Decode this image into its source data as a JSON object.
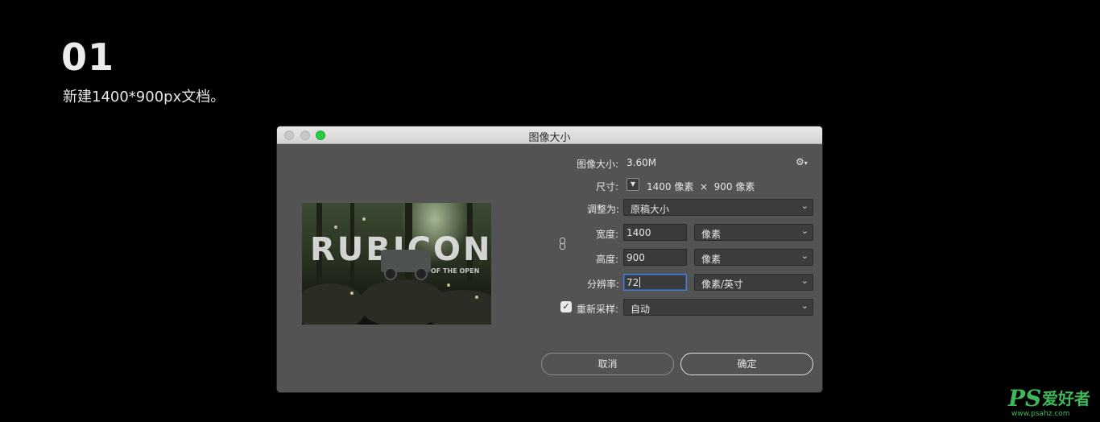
{
  "step": {
    "number": "01",
    "description": "新建1400*900px文档。"
  },
  "dialog": {
    "title": "图像大小",
    "image_size_label": "图像大小:",
    "image_size_value": "3.60M",
    "dimensions_label": "尺寸:",
    "dimensions_value": "1400 像素  ×  900 像素",
    "fit_to_label": "调整为:",
    "fit_to_value": "原稿大小",
    "width_label": "宽度:",
    "width_value": "1400",
    "width_unit": "像素",
    "height_label": "高度:",
    "height_value": "900",
    "height_unit": "像素",
    "resolution_label": "分辨率:",
    "resolution_value": "72",
    "resolution_unit": "像素/英寸",
    "resample_label": "重新采样:",
    "resample_checked": true,
    "resample_value": "自动",
    "cancel_label": "取消",
    "ok_label": "确定"
  },
  "preview": {
    "headline": "RUBICON",
    "subline": "OF THE OPEN"
  },
  "watermark": {
    "logo": "PS",
    "text": "爱好者",
    "url": "www.psahz.com"
  },
  "icons": {
    "gear": "gear-icon",
    "link": "link-chain-icon",
    "chevron": "chevron-down-icon",
    "check": "checkmark-icon"
  },
  "colors": {
    "background": "#000000",
    "dialog_bg": "#535353",
    "zoom_button": "#29c940",
    "focus_ring": "#4b80d0",
    "watermark": "#3fb85a"
  }
}
